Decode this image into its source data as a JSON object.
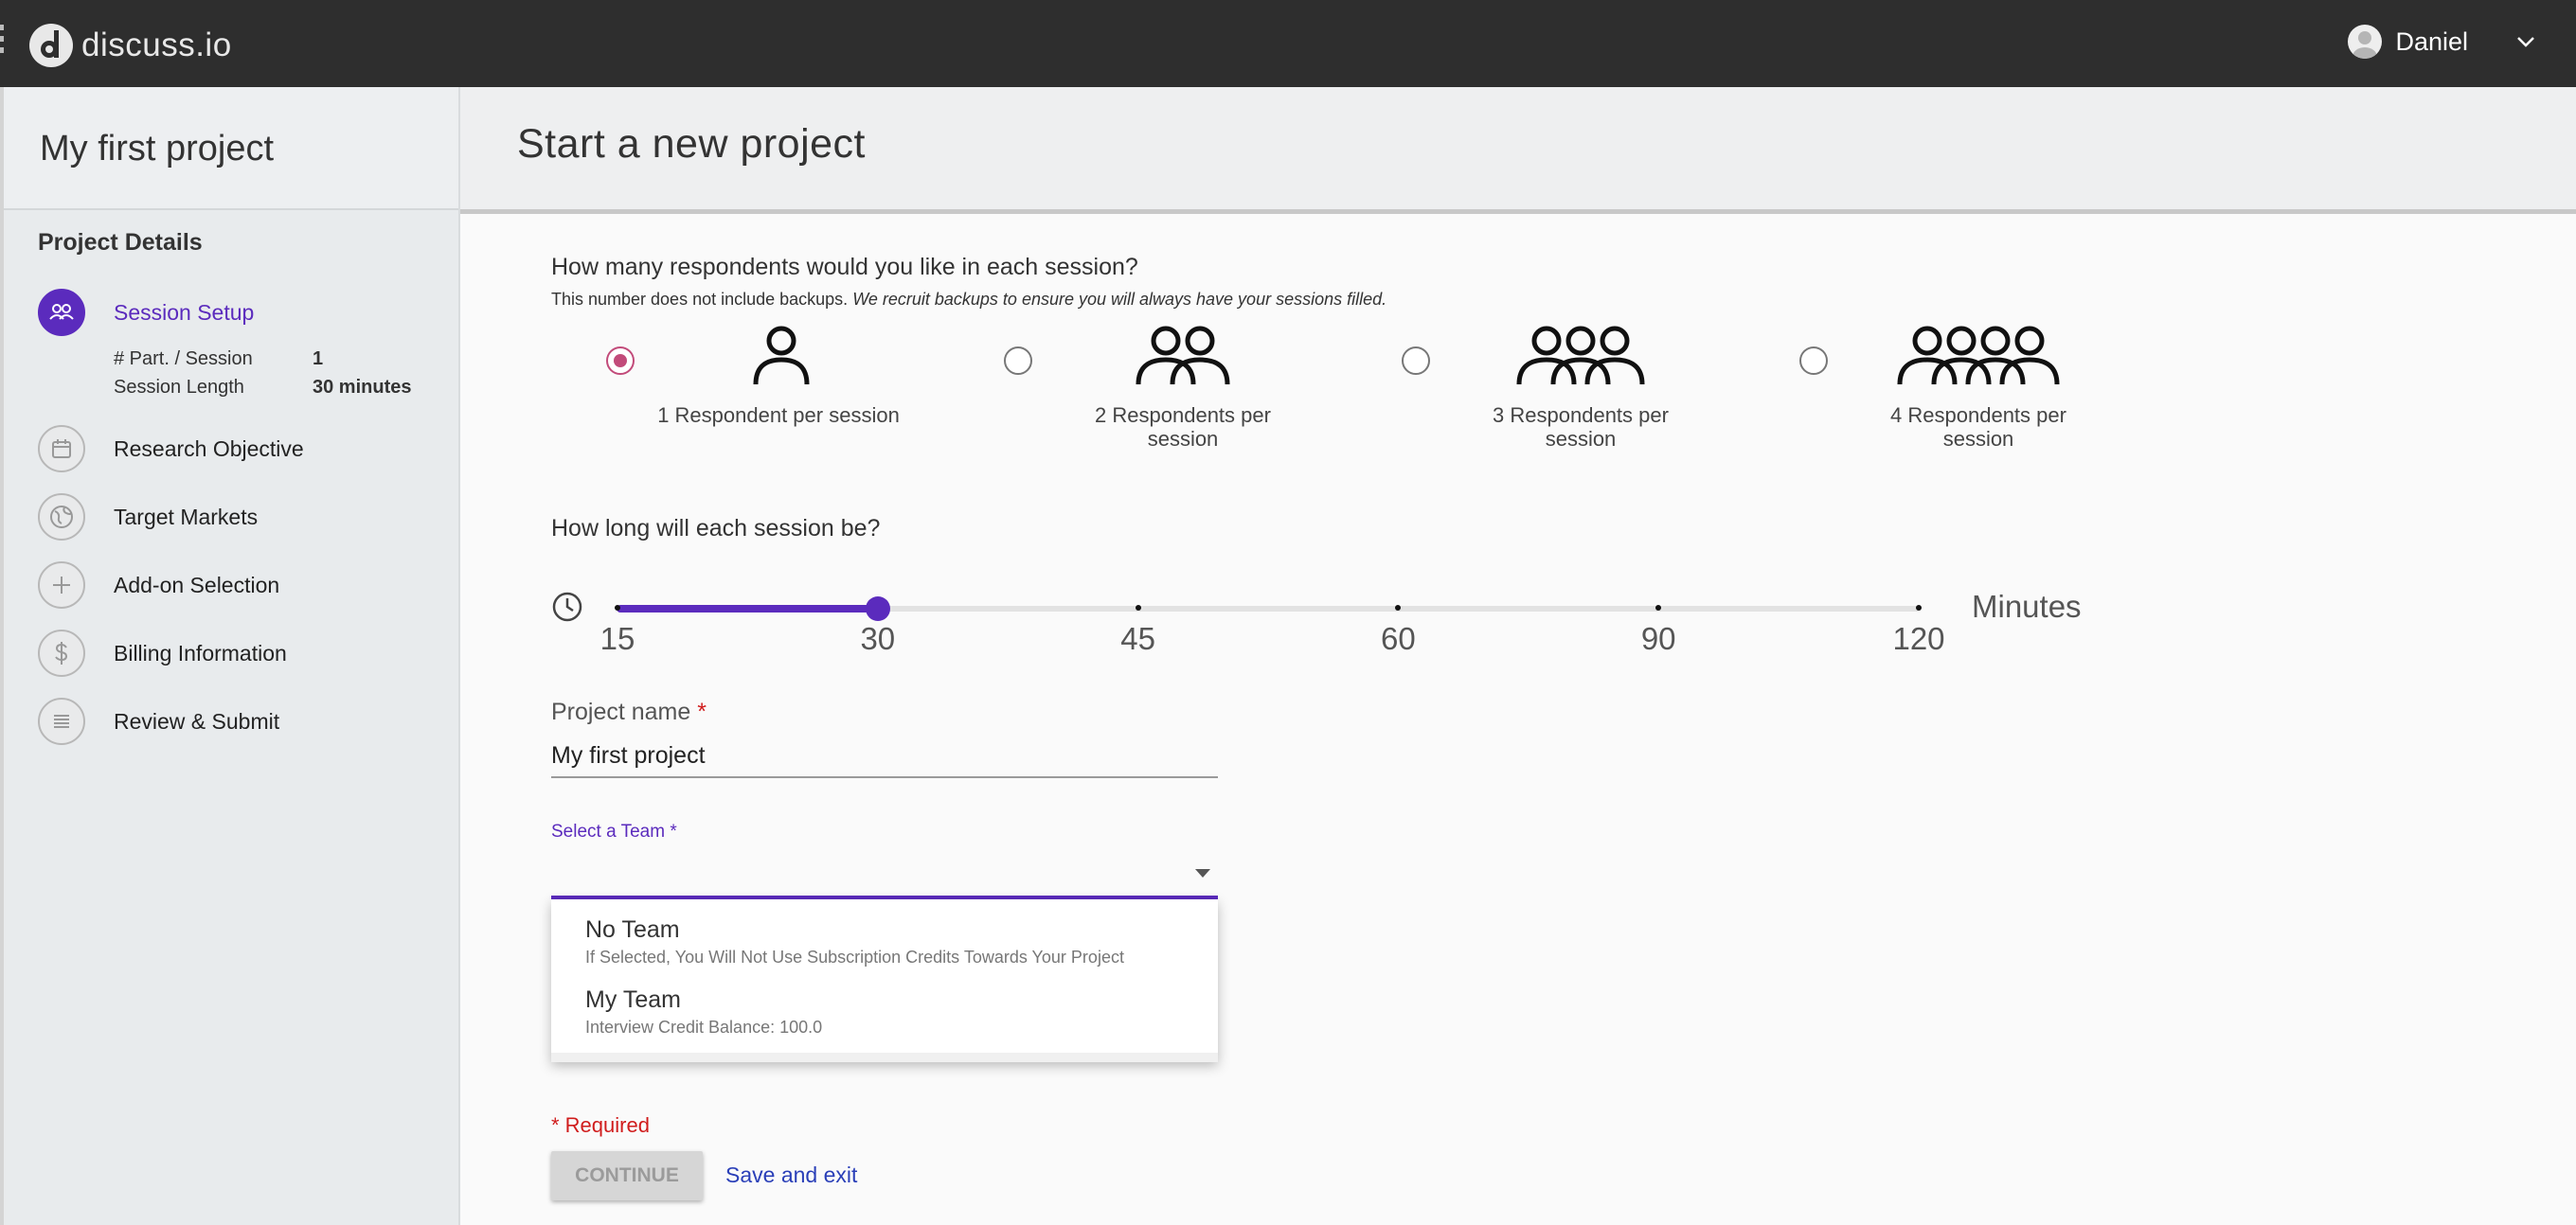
{
  "app": {
    "name": "discuss.io"
  },
  "user": {
    "name": "Daniel"
  },
  "sidebar": {
    "project_title": "My first project",
    "section_heading": "Project Details",
    "steps": [
      {
        "label": "Session Setup",
        "icon": "people-icon",
        "active": true
      },
      {
        "label": "Research Objective",
        "icon": "calendar-icon"
      },
      {
        "label": "Target Markets",
        "icon": "globe-icon"
      },
      {
        "label": "Add-on Selection",
        "icon": "plus-icon"
      },
      {
        "label": "Billing Information",
        "icon": "dollar-icon"
      },
      {
        "label": "Review & Submit",
        "icon": "list-icon"
      }
    ],
    "session_summary": {
      "participants_label": "# Part. / Session",
      "participants_value": "1",
      "length_label": "Session Length",
      "length_value": "30 minutes"
    }
  },
  "main": {
    "title": "Start a new project",
    "respondents": {
      "question": "How many respondents would you like in each session?",
      "note_plain": "This number does not include backups.",
      "note_italic": "We recruit backups to ensure you will always have your sessions filled.",
      "options": [
        {
          "label": "1 Respondent per session",
          "count": 1,
          "selected": true
        },
        {
          "label_line1": "2 Respondents per",
          "label_line2": "session",
          "count": 2
        },
        {
          "label_line1": "3 Respondents per",
          "label_line2": "session",
          "count": 3
        },
        {
          "label_line1": "4 Respondents per",
          "label_line2": "session",
          "count": 4
        }
      ]
    },
    "duration": {
      "question": "How long will each session be?",
      "ticks": [
        "15",
        "30",
        "45",
        "60",
        "90",
        "120"
      ],
      "selected": "30",
      "unit": "Minutes"
    },
    "project_name": {
      "label": "Project name",
      "required_mark": "*",
      "value": "My first project"
    },
    "team": {
      "label": "Select a Team",
      "required_mark": "*",
      "options": [
        {
          "title": "No Team",
          "subtitle": "If Selected, You Will Not Use Subscription Credits Towards Your Project"
        },
        {
          "title": "My Team",
          "subtitle": "Interview Credit Balance: 100.0"
        }
      ]
    },
    "required_note": "* Required",
    "continue_label": "CONTINUE",
    "save_exit_label": "Save and exit"
  },
  "colors": {
    "accent": "#5b2bbd",
    "radio_selected": "#c24b7a",
    "topbar": "#2e2e2e",
    "required": "#d01c1c",
    "link": "#2a3fb8"
  }
}
